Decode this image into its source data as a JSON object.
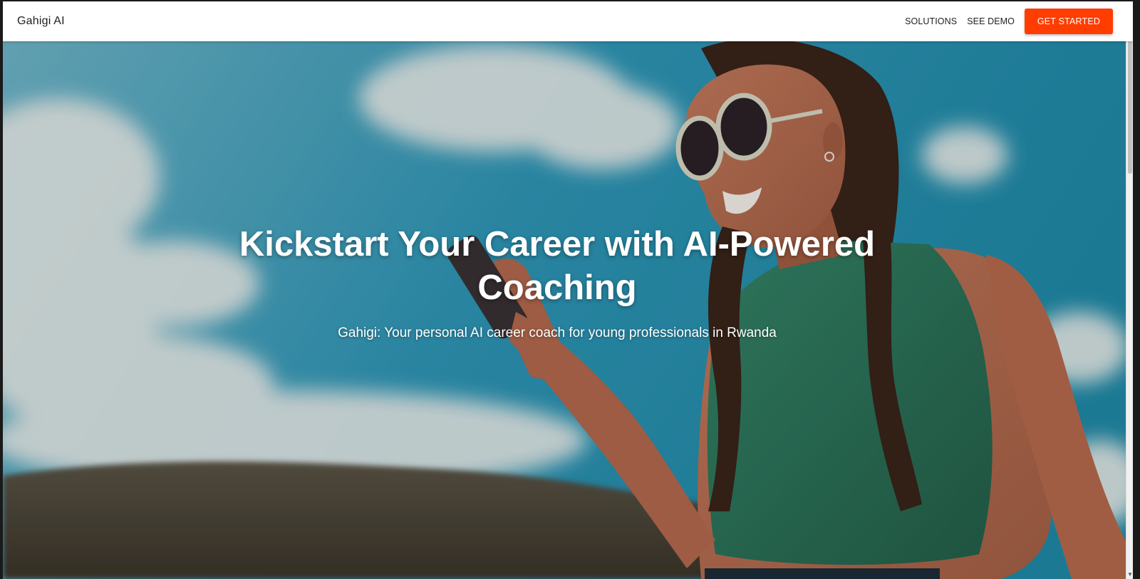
{
  "nav": {
    "brand": "Gahigi AI",
    "links": [
      "SOLUTIONS",
      "SEE DEMO"
    ],
    "cta_label": "GET STARTED"
  },
  "hero": {
    "title": "Kickstart Your Career with AI-Powered Coaching",
    "subtitle": "Gahigi: Your personal AI career coach for young professionals in Rwanda",
    "background": "photo of a smiling woman in sunglasses and a green top looking at a phone under a blue cloudy sky"
  },
  "colors": {
    "accent": "#ff3d00",
    "nav_bg": "#ffffff",
    "sky": "#3f9fb8",
    "top": "#2e7b5f"
  },
  "icons": {
    "scroll_down": "chevron-down-icon"
  }
}
